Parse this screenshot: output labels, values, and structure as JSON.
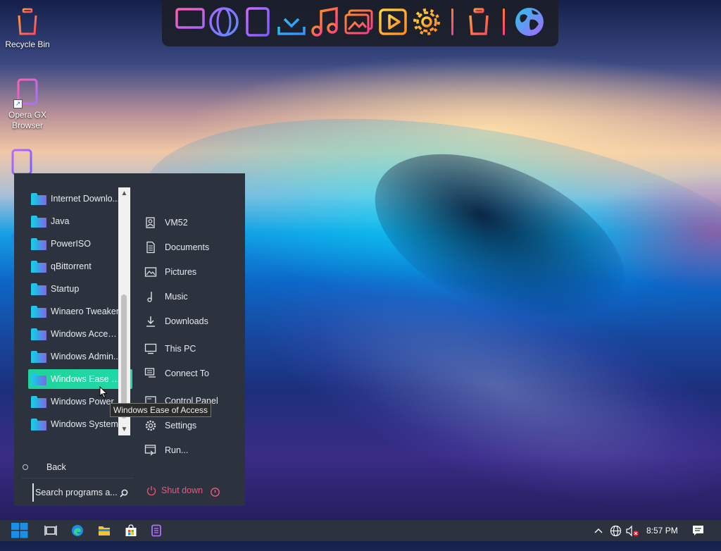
{
  "desktop": {
    "icons": [
      {
        "label": "Recycle Bin",
        "icon": "recycle-bin-icon"
      },
      {
        "label": "Opera GX Browser",
        "icon": "opera-gx-icon"
      }
    ]
  },
  "dock": {
    "items": [
      {
        "icon": "monitor-icon"
      },
      {
        "icon": "globe-icon"
      },
      {
        "icon": "documents-icon"
      },
      {
        "icon": "download-icon"
      },
      {
        "icon": "music-icon"
      },
      {
        "icon": "pictures-icon"
      },
      {
        "icon": "video-player-icon"
      },
      {
        "icon": "settings-gear-icon"
      },
      {
        "icon": "recycle-bin-icon"
      },
      {
        "icon": "internet-globe-icon"
      }
    ],
    "colors": {
      "pink": "#ff4fa3",
      "purple": "#a666ff",
      "orange": "#ff8a2a",
      "cyan": "#26c6e8",
      "yellow": "#ffd23a"
    }
  },
  "start_menu": {
    "programs": [
      {
        "label": "Internet Downlo...",
        "selected": false
      },
      {
        "label": "Java",
        "selected": false
      },
      {
        "label": "PowerISO",
        "selected": false
      },
      {
        "label": "qBittorrent",
        "selected": false
      },
      {
        "label": "Startup",
        "selected": false
      },
      {
        "label": "Winaero Tweaker",
        "selected": false
      },
      {
        "label": "Windows Access...",
        "selected": false
      },
      {
        "label": "Windows Admin...",
        "selected": false
      },
      {
        "label": "Windows Ease o...",
        "selected": true
      },
      {
        "label": "Windows Power",
        "selected": false
      },
      {
        "label": "Windows System",
        "selected": false
      }
    ],
    "places": [
      {
        "label": "VM52",
        "icon": "user-icon"
      },
      {
        "label": "Documents",
        "icon": "document-icon"
      },
      {
        "label": "Pictures",
        "icon": "picture-icon"
      },
      {
        "label": "Music",
        "icon": "music-note-icon"
      },
      {
        "label": "Downloads",
        "icon": "download-arrow-icon"
      },
      {
        "label": "This PC",
        "icon": "computer-icon"
      },
      {
        "label": "Connect To",
        "icon": "connect-icon"
      },
      {
        "label": "Control Panel",
        "icon": "control-panel-icon"
      },
      {
        "label": "Settings",
        "icon": "gear-icon"
      },
      {
        "label": "Run...",
        "icon": "run-icon"
      }
    ],
    "back_label": "Back",
    "search_placeholder": "Search programs a...",
    "shutdown_label": "Shut down",
    "colors": {
      "background": "#2c333f",
      "selected": "#21d39a",
      "shutdown": "#f0567e"
    }
  },
  "tooltip": {
    "text": "Windows Ease of Access"
  },
  "taskbar": {
    "clock": "8:57 PM",
    "pinned": [
      {
        "icon": "windows-start-icon"
      },
      {
        "icon": "task-view-icon"
      },
      {
        "icon": "edge-icon"
      },
      {
        "icon": "file-explorer-icon"
      },
      {
        "icon": "store-icon"
      },
      {
        "icon": "app-icon"
      }
    ],
    "tray": [
      {
        "icon": "chevron-up-icon"
      },
      {
        "icon": "network-icon"
      },
      {
        "icon": "volume-muted-icon"
      },
      {
        "icon": "notification-icon"
      }
    ]
  }
}
